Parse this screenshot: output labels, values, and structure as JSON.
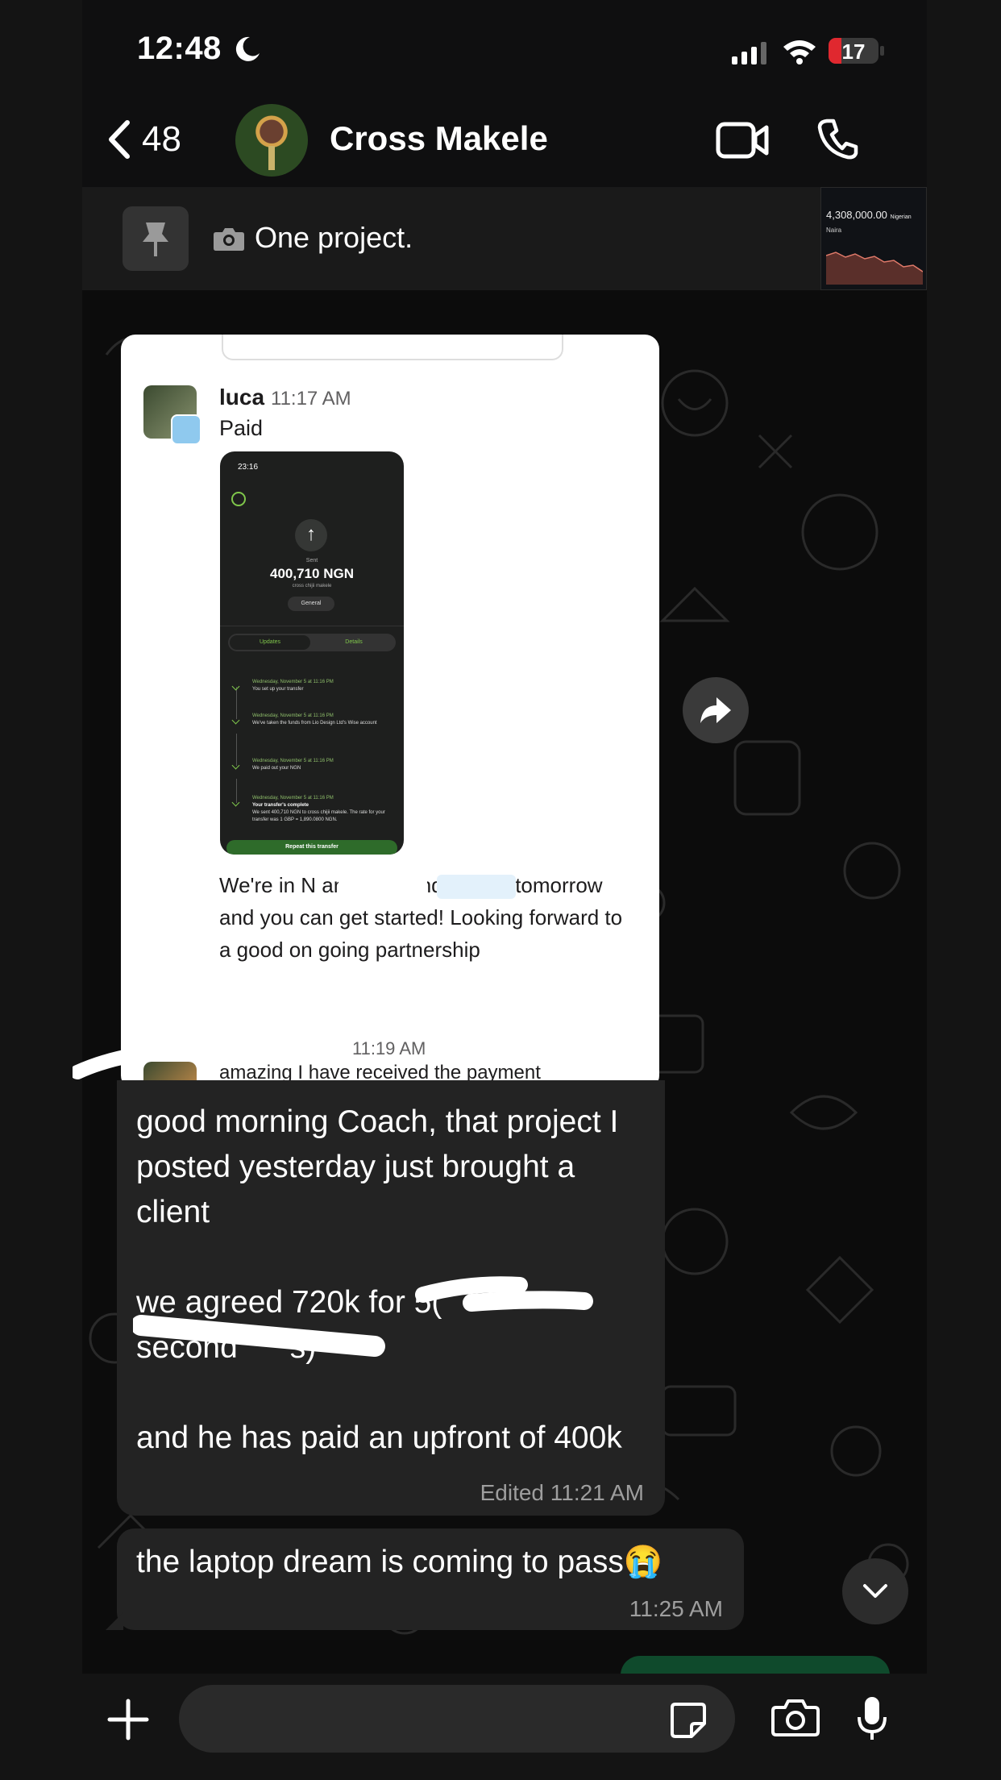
{
  "status_bar": {
    "time": "12:48",
    "battery": "17"
  },
  "header": {
    "back_count": "48",
    "contact_name": "Cross Makele"
  },
  "pinned": {
    "text": "One project.",
    "thumb_amount": "4,308,000.00",
    "thumb_currency": "Nigerian",
    "thumb_label": "Naira"
  },
  "screenshot_message": {
    "sender": "luca",
    "time": "11:17 AM",
    "text": "Paid",
    "receipt": {
      "time": "23:16",
      "sent_label": "Sent",
      "amount": "400,710 NGN",
      "recipient": "cross chijii makele",
      "chip": "General",
      "tabs": [
        "Updates",
        "Details"
      ],
      "steps": [
        {
          "date": "Wednesday, November 5 at 11:16 PM",
          "text": "You set up your transfer"
        },
        {
          "date": "Wednesday, November 5 at 11:16 PM",
          "text": "We've taken the funds from Lio Design Ltd's Wise account"
        },
        {
          "date": "Wednesday, November 5 at 11:16 PM",
          "text": "We paid out your NGN"
        },
        {
          "date": "Wednesday, November 5 at 11:16 PM",
          "text": "Your transfer's complete",
          "detail": "We sent 400,710 NGN to cross chijii makele. The rate for your transfer was 1 GBP = 1,890.0800 NGN."
        }
      ],
      "button": "Repeat this transfer"
    },
    "body": "We're in N         and              will send details tomorrow and you can get started! Looking forward to a good on going partnership",
    "second_time": "11:19 AM",
    "second_text": "amazing I have received the payment"
  },
  "messages": [
    {
      "text": "good morning Coach, that project I posted yesterday just brought a client\n\nwe agreed 720k for 5(      \nsecond      s)\n\nand he has paid an upfront of 400k",
      "meta": "Edited 11:21 AM"
    },
    {
      "text": "the laptop dream is coming to pass😭",
      "meta": "11:25 AM"
    }
  ],
  "composer": {
    "placeholder": ""
  }
}
